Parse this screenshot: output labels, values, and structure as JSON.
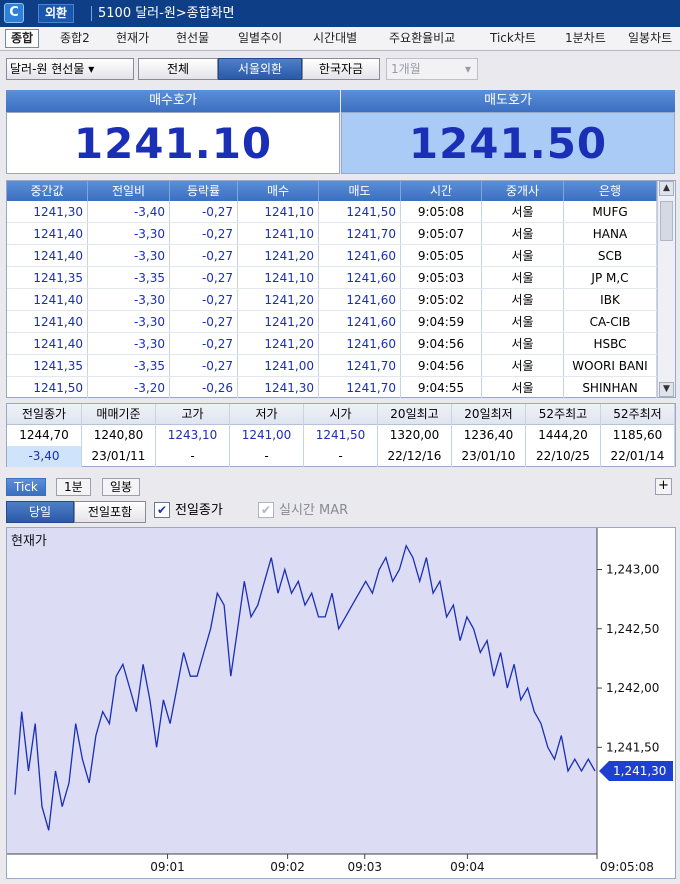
{
  "titlebar": {
    "logo": "C",
    "tag": "외환",
    "title": "5100 달러-원>종합화면"
  },
  "tabs": [
    "종합",
    "종합2",
    "현재가",
    "현선물",
    "일별추이",
    "시간대별",
    "주요환율비교",
    "Tick차트",
    "1분차트",
    "일봉차트"
  ],
  "toolbar": {
    "instrument": "달러-원 현선물 ▾",
    "filters": [
      "전체",
      "서울외환",
      "한국자금"
    ],
    "period": "1개월",
    "period_arrow": "▾"
  },
  "quote": {
    "bid_label": "매수호가",
    "bid": "1241.10",
    "ask_label": "매도호가",
    "ask": "1241.50"
  },
  "trade_table": {
    "columns": [
      "중간값",
      "전일비",
      "등락률",
      "매수",
      "매도",
      "시간",
      "중개사",
      "은행"
    ],
    "rows": [
      [
        "1241,30",
        "-3,40",
        "-0,27",
        "1241,10",
        "1241,50",
        "9:05:08",
        "서울",
        "MUFG"
      ],
      [
        "1241,40",
        "-3,30",
        "-0,27",
        "1241,10",
        "1241,70",
        "9:05:07",
        "서울",
        "HANA"
      ],
      [
        "1241,40",
        "-3,30",
        "-0,27",
        "1241,20",
        "1241,60",
        "9:05:05",
        "서울",
        "SCB"
      ],
      [
        "1241,35",
        "-3,35",
        "-0,27",
        "1241,10",
        "1241,60",
        "9:05:03",
        "서울",
        "JP M,C"
      ],
      [
        "1241,40",
        "-3,30",
        "-0,27",
        "1241,20",
        "1241,60",
        "9:05:02",
        "서울",
        "IBK"
      ],
      [
        "1241,40",
        "-3,30",
        "-0,27",
        "1241,20",
        "1241,60",
        "9:04:59",
        "서울",
        "CA-CIB"
      ],
      [
        "1241,40",
        "-3,30",
        "-0,27",
        "1241,20",
        "1241,60",
        "9:04:56",
        "서울",
        "HSBC"
      ],
      [
        "1241,35",
        "-3,35",
        "-0,27",
        "1241,00",
        "1241,70",
        "9:04:56",
        "서울",
        "WOORI BANI"
      ],
      [
        "1241,50",
        "-3,20",
        "-0,26",
        "1241,30",
        "1241,70",
        "9:04:55",
        "서울",
        "SHINHAN"
      ]
    ],
    "scroll_up": "▲",
    "scroll_down": "▼"
  },
  "summary": {
    "headers": [
      "전일종가",
      "매매기준",
      "고가",
      "저가",
      "시가",
      "20일최고",
      "20일최저",
      "52주최고",
      "52주최저"
    ],
    "row1": [
      "1244,70",
      "1240,80",
      "1243,10",
      "1241,00",
      "1241,50",
      "1320,00",
      "1236,40",
      "1444,20",
      "1185,60"
    ],
    "row2": [
      "-3,40",
      "23/01/11",
      "-",
      "-",
      "-",
      "22/12/16",
      "23/01/10",
      "22/10/25",
      "22/01/14"
    ]
  },
  "chart_tabs": {
    "tabs": [
      "Tick",
      "1분",
      "일봉"
    ],
    "plus": "+"
  },
  "chart_controls": {
    "buttons": [
      "당일",
      "전일포함"
    ],
    "check1": {
      "label": "전일종가",
      "mark": "✔"
    },
    "check2": {
      "label": "실시간 MAR",
      "mark": "✔"
    }
  },
  "chart_data": {
    "type": "area",
    "title": "현재가",
    "x_labels": [
      "09:01",
      "09:02",
      "09:03",
      "09:04",
      "09:05:08"
    ],
    "y_ticks": [
      "1,243,00",
      "1,242,50",
      "1,242,00",
      "1,241,50"
    ],
    "y_tick_values": [
      1243.0,
      1242.5,
      1242.0,
      1241.5
    ],
    "ylim": [
      1240.6,
      1243.35
    ],
    "current_label": "1,241,30",
    "current_value": 1241.3,
    "series": [
      {
        "values": [
          1241.1,
          1241.8,
          1241.3,
          1241.7,
          1241.0,
          1240.8,
          1241.3,
          1241.0,
          1241.2,
          1241.7,
          1241.4,
          1241.2,
          1241.6,
          1241.8,
          1241.7,
          1242.1,
          1242.2,
          1242.0,
          1241.8,
          1242.2,
          1241.9,
          1241.5,
          1241.9,
          1241.7,
          1242.0,
          1242.3,
          1242.1,
          1242.1,
          1242.3,
          1242.5,
          1242.8,
          1242.7,
          1242.1,
          1242.5,
          1242.9,
          1242.6,
          1242.7,
          1242.9,
          1243.1,
          1242.8,
          1243.0,
          1242.8,
          1242.9,
          1242.7,
          1242.8,
          1242.6,
          1242.6,
          1242.8,
          1242.5,
          1242.6,
          1242.7,
          1242.8,
          1242.9,
          1242.8,
          1243.0,
          1243.1,
          1242.9,
          1243.0,
          1243.2,
          1243.1,
          1242.9,
          1243.1,
          1242.8,
          1242.9,
          1242.6,
          1242.7,
          1242.4,
          1242.6,
          1242.5,
          1242.3,
          1242.4,
          1242.1,
          1242.3,
          1242.0,
          1242.2,
          1241.9,
          1242.0,
          1241.8,
          1241.7,
          1241.5,
          1241.4,
          1241.6,
          1241.3,
          1241.4,
          1241.3,
          1241.4,
          1241.3
        ]
      }
    ]
  },
  "colors": {
    "accent": "#3b6fc0",
    "price": "#1a2fb6",
    "chart_fill": "#dcdcf4",
    "line": "#1a2fb6"
  }
}
